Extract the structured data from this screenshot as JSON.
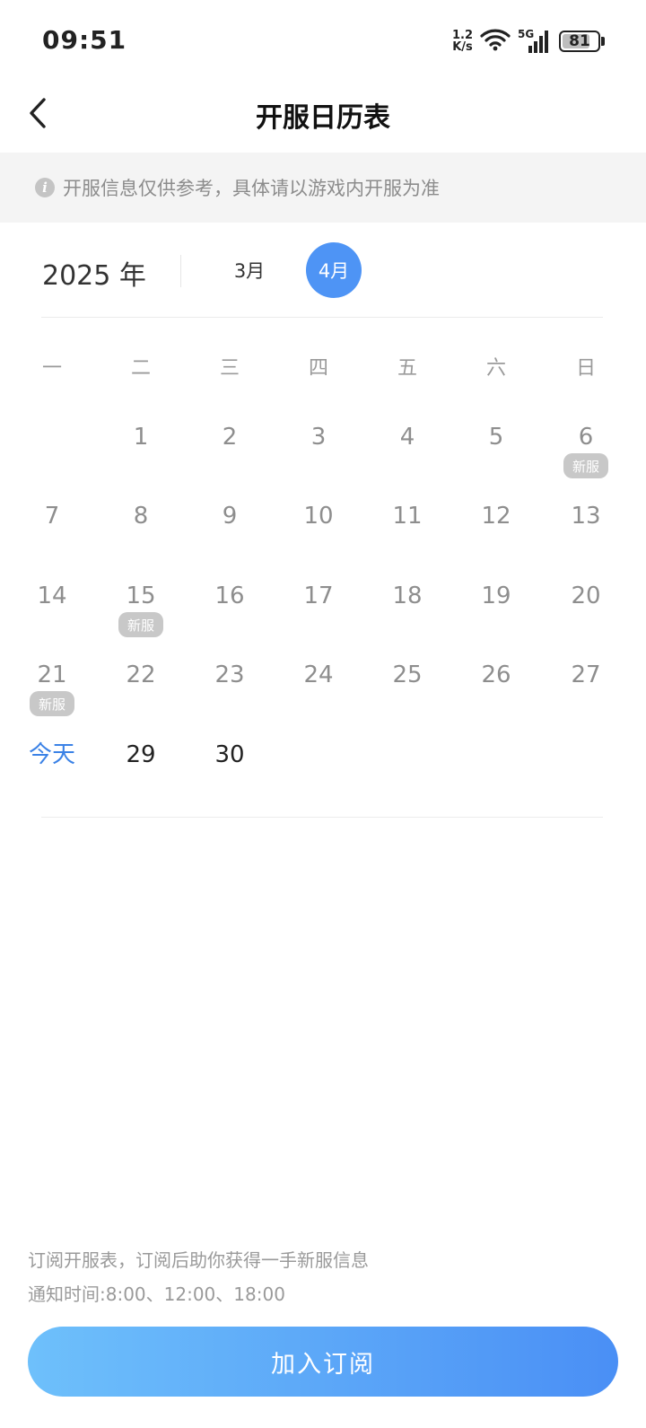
{
  "status_bar": {
    "time": "09:51",
    "net_speed_value": "1.2",
    "net_speed_unit": "K/s",
    "network_label": "5G",
    "battery": "81",
    "battery_level": 0.81
  },
  "header": {
    "title": "开服日历表"
  },
  "notice": {
    "icon_text": "i",
    "text": "开服信息仅供参考，具体请以游戏内开服为准"
  },
  "selector": {
    "year": "2025 年",
    "months": [
      {
        "label": "3月",
        "selected": false
      },
      {
        "label": "4月",
        "selected": true
      }
    ]
  },
  "calendar": {
    "weekdays": [
      "一",
      "二",
      "三",
      "四",
      "五",
      "六",
      "日"
    ],
    "badge_label": "新服",
    "days": [
      {
        "label": "1",
        "col": 1,
        "row": 0,
        "badge": false,
        "style": "grey"
      },
      {
        "label": "2",
        "col": 2,
        "row": 0,
        "badge": false,
        "style": "grey"
      },
      {
        "label": "3",
        "col": 3,
        "row": 0,
        "badge": false,
        "style": "grey"
      },
      {
        "label": "4",
        "col": 4,
        "row": 0,
        "badge": false,
        "style": "grey"
      },
      {
        "label": "5",
        "col": 5,
        "row": 0,
        "badge": false,
        "style": "grey"
      },
      {
        "label": "6",
        "col": 6,
        "row": 0,
        "badge": true,
        "style": "grey"
      },
      {
        "label": "7",
        "col": 0,
        "row": 1,
        "badge": false,
        "style": "grey"
      },
      {
        "label": "8",
        "col": 1,
        "row": 1,
        "badge": false,
        "style": "grey"
      },
      {
        "label": "9",
        "col": 2,
        "row": 1,
        "badge": false,
        "style": "grey"
      },
      {
        "label": "10",
        "col": 3,
        "row": 1,
        "badge": false,
        "style": "grey"
      },
      {
        "label": "11",
        "col": 4,
        "row": 1,
        "badge": false,
        "style": "grey"
      },
      {
        "label": "12",
        "col": 5,
        "row": 1,
        "badge": false,
        "style": "grey"
      },
      {
        "label": "13",
        "col": 6,
        "row": 1,
        "badge": false,
        "style": "grey"
      },
      {
        "label": "14",
        "col": 0,
        "row": 2,
        "badge": false,
        "style": "grey"
      },
      {
        "label": "15",
        "col": 1,
        "row": 2,
        "badge": true,
        "style": "grey"
      },
      {
        "label": "16",
        "col": 2,
        "row": 2,
        "badge": false,
        "style": "grey"
      },
      {
        "label": "17",
        "col": 3,
        "row": 2,
        "badge": false,
        "style": "grey"
      },
      {
        "label": "18",
        "col": 4,
        "row": 2,
        "badge": false,
        "style": "grey"
      },
      {
        "label": "19",
        "col": 5,
        "row": 2,
        "badge": false,
        "style": "grey"
      },
      {
        "label": "20",
        "col": 6,
        "row": 2,
        "badge": false,
        "style": "grey"
      },
      {
        "label": "21",
        "col": 0,
        "row": 3,
        "badge": true,
        "style": "grey"
      },
      {
        "label": "22",
        "col": 1,
        "row": 3,
        "badge": false,
        "style": "grey"
      },
      {
        "label": "23",
        "col": 2,
        "row": 3,
        "badge": false,
        "style": "grey"
      },
      {
        "label": "24",
        "col": 3,
        "row": 3,
        "badge": false,
        "style": "grey"
      },
      {
        "label": "25",
        "col": 4,
        "row": 3,
        "badge": false,
        "style": "grey"
      },
      {
        "label": "26",
        "col": 5,
        "row": 3,
        "badge": false,
        "style": "grey"
      },
      {
        "label": "27",
        "col": 6,
        "row": 3,
        "badge": false,
        "style": "grey"
      },
      {
        "label": "今天",
        "col": 0,
        "row": 4,
        "badge": false,
        "style": "today"
      },
      {
        "label": "29",
        "col": 1,
        "row": 4,
        "badge": false,
        "style": "dark"
      },
      {
        "label": "30",
        "col": 2,
        "row": 4,
        "badge": false,
        "style": "dark"
      }
    ]
  },
  "footer": {
    "line1": "订阅开服表，订阅后助你获得一手新服信息",
    "line2": "通知时间:8:00、12:00、18:00",
    "subscribe_label": "加入订阅"
  },
  "colors": {
    "accent": "#4e94f5",
    "today": "#3b82e6",
    "badge": "#c8c8c8",
    "button_gradient_start": "#6ec0fb",
    "button_gradient_end": "#4a8ff5"
  }
}
